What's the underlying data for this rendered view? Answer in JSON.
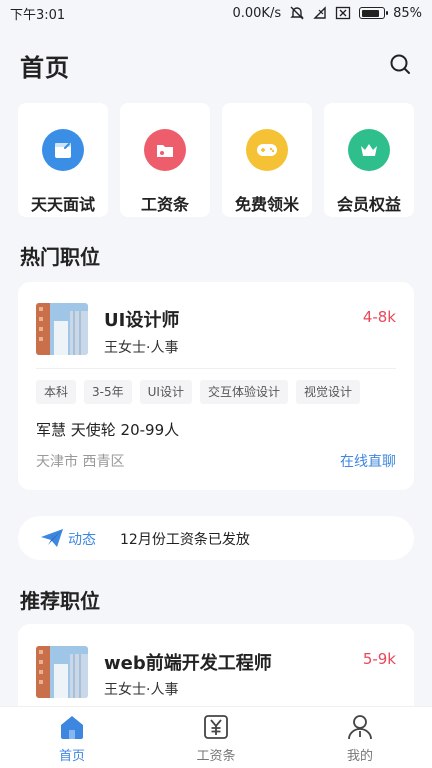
{
  "status_bar": {
    "time": "下午3:01",
    "network_speed": "0.00K/s",
    "battery": "85%",
    "battery_level": 0.85
  },
  "header": {
    "title": "首页"
  },
  "quick_links": [
    {
      "label": "天天面试",
      "icon": "interview-icon",
      "color": "#3a8ee6"
    },
    {
      "label": "工资条",
      "icon": "salary-folder-icon",
      "color": "#ee5d6c"
    },
    {
      "label": "免费领米",
      "icon": "gamepad-icon",
      "color": "#f5c235"
    },
    {
      "label": "会员权益",
      "icon": "crown-icon",
      "color": "#2fbf8c"
    }
  ],
  "hot_section": {
    "title": "热门职位",
    "job": {
      "title": "UI设计师",
      "salary": "4-8k",
      "contact": "王女士·人事",
      "tags": [
        "本科",
        "3-5年",
        "UI设计",
        "交互体验设计",
        "视觉设计"
      ],
      "company": "军慧 天使轮 20-99人",
      "location": "天津市 西青区",
      "chat_label": "在线直聊"
    }
  },
  "news": {
    "tag": "动态",
    "text": "12月份工资条已发放"
  },
  "recommend_section": {
    "title": "推荐职位",
    "job": {
      "title": "web前端开发工程师",
      "salary": "5-9k",
      "contact": "王女士·人事"
    }
  },
  "tabbar": [
    {
      "label": "首页",
      "icon": "home-icon",
      "active": true
    },
    {
      "label": "工资条",
      "icon": "yen-icon",
      "active": false
    },
    {
      "label": "我的",
      "icon": "user-icon",
      "active": false
    }
  ],
  "colors": {
    "accent": "#3e87e0",
    "salary": "#e8485a",
    "background": "#f5f6fa"
  }
}
